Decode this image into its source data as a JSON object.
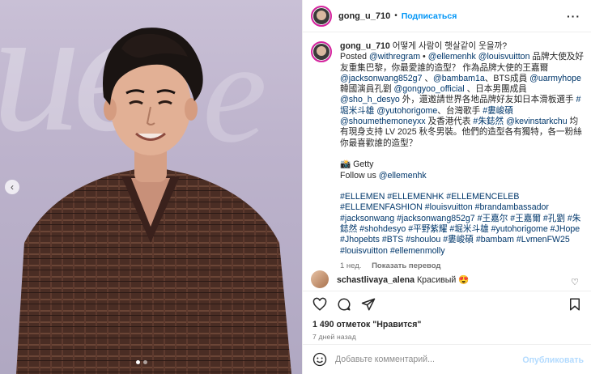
{
  "post": {
    "username": "gong_u_710",
    "separator": "•",
    "follow_label": "Подписаться"
  },
  "caption": {
    "username": "gong_u_710",
    "line1": "어떻게 사람이 햇살같이 웃을까?",
    "segments": [
      {
        "t": "Posted ",
        "k": "text"
      },
      {
        "t": "@withregram",
        "k": "tag"
      },
      {
        "t": " • ",
        "k": "text"
      },
      {
        "t": "@ellemenhk",
        "k": "tag"
      },
      {
        "t": " ",
        "k": "text"
      },
      {
        "t": "@louisvuitton",
        "k": "tag"
      },
      {
        "t": " 品牌大使及好友重集巴黎，你最愛誰的造型？ 作為品牌大使的王嘉爾 ",
        "k": "text"
      },
      {
        "t": "@jacksonwang852g7",
        "k": "tag"
      },
      {
        "t": " 、",
        "k": "text"
      },
      {
        "t": "@bambam1a",
        "k": "tag"
      },
      {
        "t": "、BTS成員 ",
        "k": "text"
      },
      {
        "t": "@uarmyhope",
        "k": "tag"
      },
      {
        "t": " 韓國演員孔劉 ",
        "k": "text"
      },
      {
        "t": "@gongyoo_official",
        "k": "tag"
      },
      {
        "t": " 、日本男團成員 ",
        "k": "text"
      },
      {
        "t": "@sho_h_desyo",
        "k": "tag"
      },
      {
        "t": " 外，還邀請世界各地品牌好友如日本滑板選手 ",
        "k": "text"
      },
      {
        "t": "#堀米斗雄",
        "k": "tag"
      },
      {
        "t": " ",
        "k": "text"
      },
      {
        "t": "@yutohorigome",
        "k": "tag"
      },
      {
        "t": "、台灣歌手 ",
        "k": "text"
      },
      {
        "t": "#婁峻碩",
        "k": "tag"
      },
      {
        "t": " ",
        "k": "text"
      },
      {
        "t": "@shoumethemoneyxx",
        "k": "tag"
      },
      {
        "t": " 及香港代表 ",
        "k": "text"
      },
      {
        "t": "#朱鋕然",
        "k": "tag"
      },
      {
        "t": " ",
        "k": "text"
      },
      {
        "t": "@kevinstarkchu",
        "k": "tag"
      },
      {
        "t": " 均有現身支持 LV 2025 秋冬男裝。他們的造型各有獨特，各一粉絲你最喜歡誰的造型？",
        "k": "text"
      }
    ],
    "credit": "📸 Getty",
    "follow_prefix": "Follow us ",
    "follow_handle": "@ellemenhk",
    "hashtags": "#ELLEMEN #ELLEMENHK #ELLEMENCELEB #ELLEMENFASHION #louisvuitton #brandambassador #jacksonwang #jacksonwang852g7 #王嘉尔 #王嘉爾 #孔劉 #朱鋕然 #shohdesyo #平野紫耀 #堀米斗雄 #yutohorigome #JHope #Jhopebts #BTS #shoulou #婁峻碩 #bambam #LvmenFW25 #louisvuitton #ellemenmolly",
    "time_ago": "1 нед.",
    "translate_label": "Показать перевод"
  },
  "comment": {
    "username": "schastlivaya_alena",
    "text": "Красивый 😍"
  },
  "likes": "1 490 отметок \"Нравится\"",
  "date": "7 дней назад",
  "add_comment": {
    "placeholder": "Добавьте комментарий...",
    "publish_label": "Опубликовать"
  },
  "icons": [
    "more-icon",
    "heart-icon",
    "comment-icon",
    "share-icon",
    "save-icon",
    "emoji-icon",
    "chevron-left-icon"
  ],
  "colors": {
    "link": "#00376b",
    "follow": "#0095f6",
    "publish_disabled": "#b3dbff",
    "muted": "#737373"
  }
}
